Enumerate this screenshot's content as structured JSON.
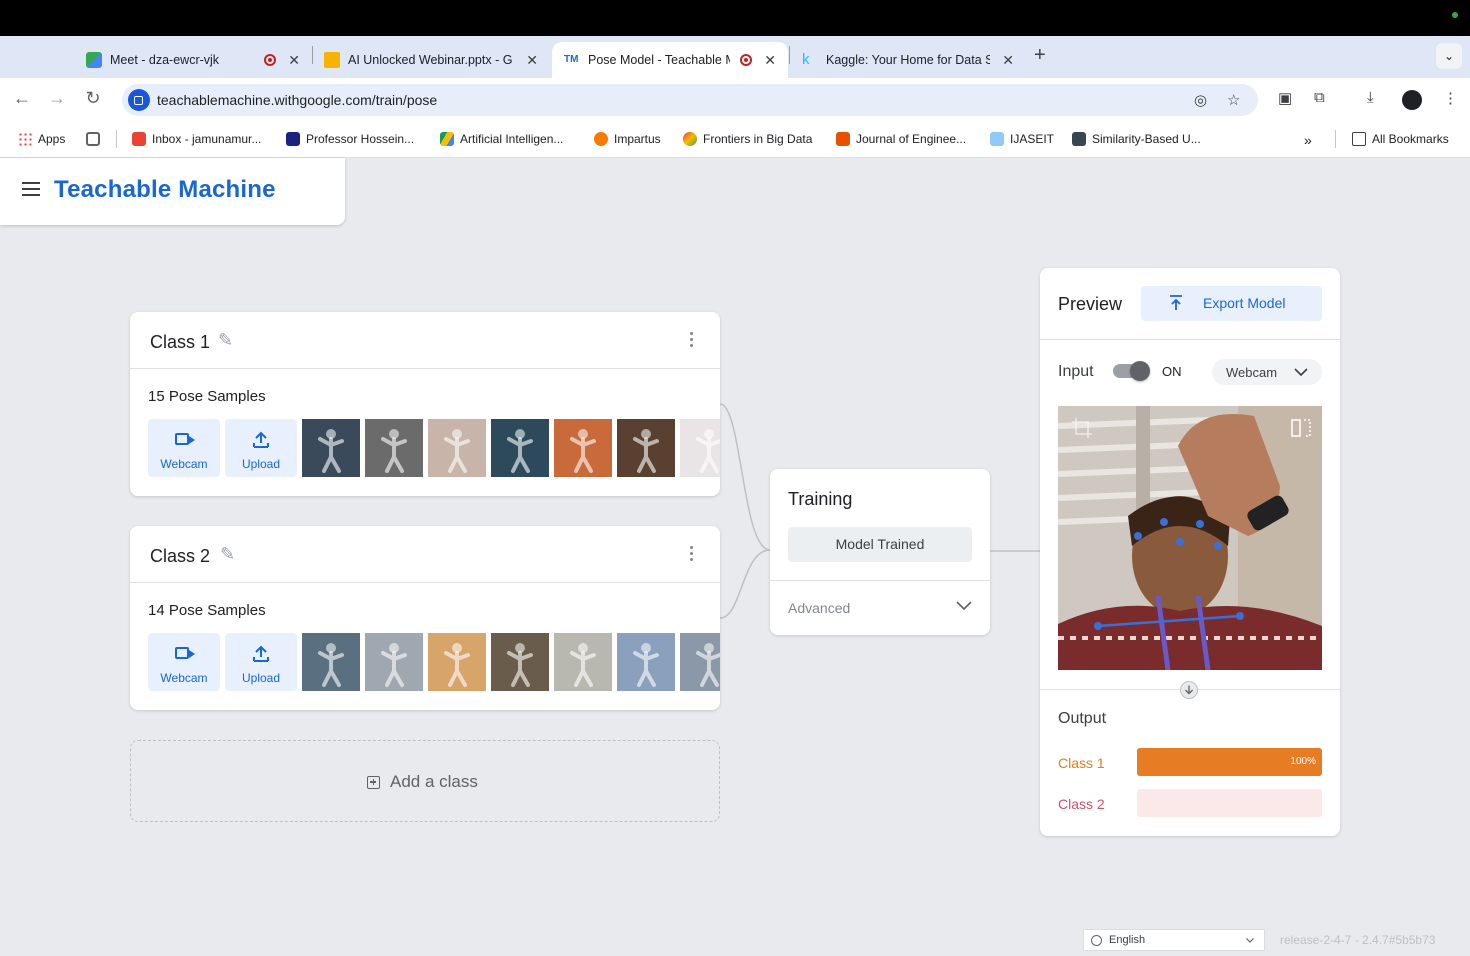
{
  "browser": {
    "tabs": [
      {
        "title": "Meet - dza-ewcr-vjk",
        "recording": true,
        "favicon_color": "#34a853"
      },
      {
        "title": "AI Unlocked Webinar.pptx - G",
        "recording": false,
        "favicon_color": "#f4b400"
      },
      {
        "title": "Pose Model - Teachable M",
        "recording": true,
        "favicon_color": "#1967d2",
        "favicon_text": "TM"
      },
      {
        "title": "Kaggle: Your Home for Data S",
        "recording": false,
        "favicon_color": "#20beff",
        "favicon_text": "k"
      }
    ],
    "url": "teachablemachine.withgoogle.com/train/pose",
    "bookmarks": [
      {
        "label": "Apps",
        "color": "#ea4335"
      },
      {
        "label": "",
        "color": "#5f6368"
      },
      {
        "label": "Inbox - jamunamur...",
        "color": "#ea4335"
      },
      {
        "label": "Professor Hossein...",
        "color": "#1a237e"
      },
      {
        "label": "Artificial Intelligen...",
        "color": "#fbbc04"
      },
      {
        "label": "Impartus",
        "color": "#f57c00"
      },
      {
        "label": "Frontiers in Big Data",
        "color": "#e53935"
      },
      {
        "label": "Journal of Enginee...",
        "color": "#e65100"
      },
      {
        "label": "IJASEIT",
        "color": "#1565c0"
      },
      {
        "label": "Similarity-Based U...",
        "color": "#37474f"
      }
    ],
    "all_bookmarks": "All Bookmarks"
  },
  "app": {
    "brand": "Teachable Machine"
  },
  "classes": [
    {
      "name": "Class 1",
      "samples_text": "15 Pose Samples",
      "webcam_label": "Webcam",
      "upload_label": "Upload",
      "thumb_colors": [
        "#3b4a5a",
        "#6b6b6b",
        "#c8b4a8",
        "#2c4a5c",
        "#c96a3a",
        "#5a4030",
        "#e9e4e6"
      ]
    },
    {
      "name": "Class 2",
      "samples_text": "14 Pose Samples",
      "webcam_label": "Webcam",
      "upload_label": "Upload",
      "thumb_colors": [
        "#5a7080",
        "#9fa8b0",
        "#d7a46a",
        "#6a5c4a",
        "#b8b8b0",
        "#8aa0bc",
        "#8a98a8"
      ]
    }
  ],
  "add_class": "Add a class",
  "training": {
    "title": "Training",
    "button": "Model Trained",
    "advanced": "Advanced"
  },
  "preview": {
    "title": "Preview",
    "export_label": "Export Model",
    "input_label": "Input",
    "input_state": "ON",
    "source": "Webcam",
    "output_label": "Output",
    "results": [
      {
        "label": "Class 1",
        "value": 1.0,
        "percent_text": "100%"
      },
      {
        "label": "Class 2",
        "value": 0.0,
        "percent_text": ""
      }
    ]
  },
  "footer": {
    "language": "English",
    "release": "release-2-4-7 - 2.4.7#5b5b73"
  }
}
